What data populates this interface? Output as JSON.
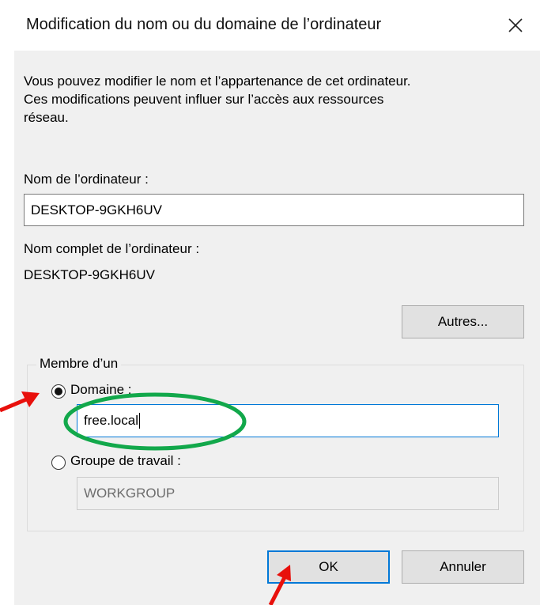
{
  "dialog": {
    "title": "Modification du nom ou du domaine de l’ordinateur",
    "intro": "Vous pouvez modifier le nom et l’appartenance de cet ordinateur.\nCes modifications peuvent influer sur l’accès aux ressources\nréseau."
  },
  "computer_name": {
    "label": "Nom de l’ordinateur :",
    "value": "DESKTOP-9GKH6UV"
  },
  "full_name": {
    "label": "Nom complet de l’ordinateur :",
    "value": "DESKTOP-9GKH6UV"
  },
  "buttons": {
    "more": "Autres...",
    "ok": "OK",
    "cancel": "Annuler"
  },
  "membership": {
    "legend": "Membre d’un",
    "domain_label": "Domaine :",
    "domain_value": "free.local",
    "domain_selected": true,
    "workgroup_label": "Groupe de travail :",
    "workgroup_value": "WORKGROUP"
  },
  "colors": {
    "annotation_arrow": "#e8100c",
    "annotation_ellipse": "#12a84b",
    "focus_border": "#0078d7"
  }
}
